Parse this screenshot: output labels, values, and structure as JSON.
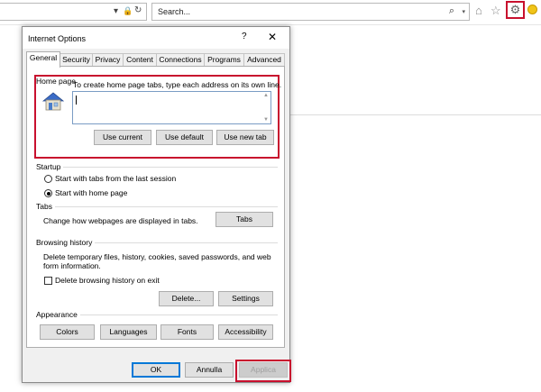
{
  "browser": {
    "search_placeholder": "Search...",
    "addr_dropdown_glyph": "▾",
    "lock_glyph": "🔒",
    "refresh_glyph": "↻",
    "search_glyph": "⌕",
    "home_glyph": "⌂",
    "star_glyph": "☆",
    "gear_glyph": "⚙"
  },
  "dialog": {
    "title": "Internet Options",
    "help": "?",
    "close": "✕",
    "tabs": [
      "General",
      "Security",
      "Privacy",
      "Content",
      "Connections",
      "Programs",
      "Advanced"
    ],
    "home_page": {
      "label": "Home page",
      "description": "To create home page tabs, type each address on its own line.",
      "value": "",
      "buttons": [
        "Use current",
        "Use default",
        "Use new tab"
      ]
    },
    "startup": {
      "label": "Startup",
      "options": [
        "Start with tabs from the last session",
        "Start with home page"
      ],
      "selected_index": 1
    },
    "tabs_section": {
      "label": "Tabs",
      "description": "Change how webpages are displayed in tabs.",
      "button": "Tabs"
    },
    "browsing_history": {
      "label": "Browsing history",
      "description_line1": "Delete temporary files, history, cookies, saved passwords, and web",
      "description_line2": "form information.",
      "checkbox_label": "Delete browsing history on exit",
      "checked": false,
      "buttons": [
        "Delete...",
        "Settings"
      ]
    },
    "appearance": {
      "label": "Appearance",
      "buttons": [
        "Colors",
        "Languages",
        "Fonts",
        "Accessibility"
      ]
    },
    "footer": {
      "ok": "OK",
      "cancel": "Annulla",
      "apply": "Applica"
    }
  },
  "colors": {
    "highlight_red": "#c8102e",
    "accent_blue": "#0078d7"
  }
}
